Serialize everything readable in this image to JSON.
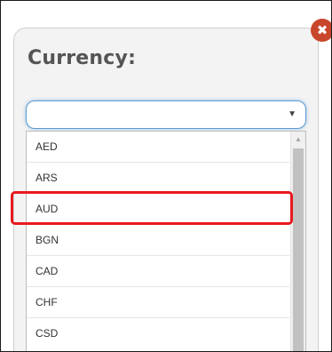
{
  "dialog": {
    "title": "Currency:",
    "close_icon": "close-x-circle-icon",
    "close_symbol": "✖"
  },
  "select": {
    "value": "",
    "arrow_icon": "caret-down-icon",
    "arrow_symbol": "▼"
  },
  "dropdown": {
    "options": [
      "AED",
      "ARS",
      "AUD",
      "BGN",
      "CAD",
      "CHF",
      "CSD"
    ],
    "highlighted": "AUD",
    "scroll_up_symbol": "▲"
  },
  "colors": {
    "close_button": "#c8462b",
    "highlight_border": "#e8191f",
    "select_focus": "#5b9bd5"
  }
}
